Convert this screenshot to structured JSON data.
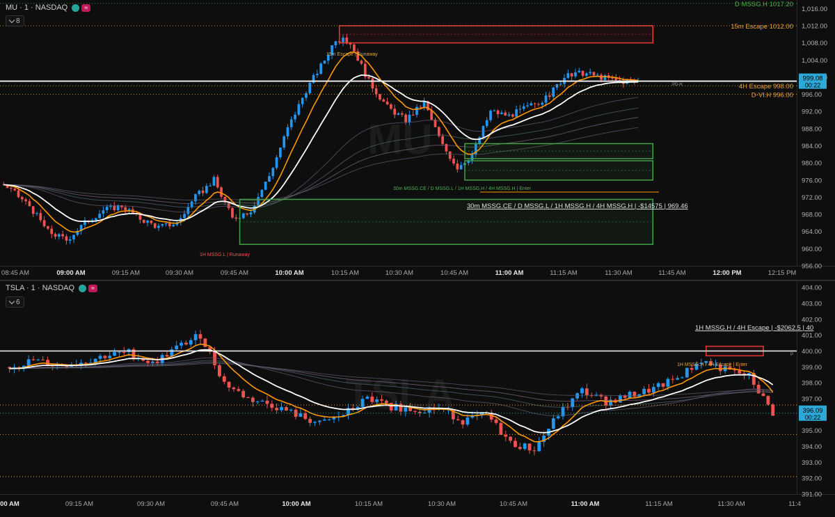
{
  "panes": [
    {
      "symbol_title": "MU · 1 · NASDAQ",
      "indicator_count": "8",
      "watermark": "MU",
      "price_tag": {
        "value": "999.08",
        "time": "00:22"
      },
      "y_ticks": [
        "1,016.00",
        "1,012.00",
        "1,008.00",
        "1,004.00",
        "1,000.00",
        "996.00",
        "992.00",
        "988.00",
        "984.00",
        "980.00",
        "976.00",
        "972.00",
        "968.00",
        "964.00",
        "960.00",
        "956.00"
      ],
      "x_ticks": [
        {
          "label": "08:45 AM",
          "bold": false
        },
        {
          "label": "09:00 AM",
          "bold": true
        },
        {
          "label": "09:15 AM",
          "bold": false
        },
        {
          "label": "09:30 AM",
          "bold": false
        },
        {
          "label": "09:45 AM",
          "bold": false
        },
        {
          "label": "10:00 AM",
          "bold": true
        },
        {
          "label": "10:15 AM",
          "bold": false
        },
        {
          "label": "10:30 AM",
          "bold": false
        },
        {
          "label": "10:45 AM",
          "bold": false
        },
        {
          "label": "11:00 AM",
          "bold": true
        },
        {
          "label": "11:15 AM",
          "bold": false
        },
        {
          "label": "11:30 AM",
          "bold": false
        },
        {
          "label": "11:45 AM",
          "bold": false
        },
        {
          "label": "12:00 PM",
          "bold": true
        },
        {
          "label": "12:15 PM",
          "bold": false
        }
      ],
      "levels": [
        {
          "label": "D MSSG.H  1017.20",
          "color": "#4caf50",
          "value": 1017.2
        },
        {
          "label": "15m Escape  1012.00",
          "color": "#e6a23c",
          "value": 1012.0
        },
        {
          "label": "4H Escape  998.00",
          "color": "#e6a23c",
          "value": 998.0
        },
        {
          "label": "D-VI.H  996.00",
          "color": "#e6a23c",
          "value": 996.0
        }
      ],
      "annotations": [
        {
          "text": "15m Escape | Runaway",
          "color": "#e6a23c"
        },
        {
          "text": "30m MSSG.CE / D MSSG.L / 1H MSSG.H / 4H MSSG.H | Enter",
          "color": "#4caf50"
        },
        {
          "text": "30m MSSG.CE / D MSSG.L / 1H MSSG.H / 4H MSSG.H | -$14575 | 969.46",
          "color": "#e0e0e0"
        },
        {
          "text": "1H MSSG.L | Runaway",
          "color": "#ef5350"
        },
        {
          "text": "PD-H",
          "color": "#9e9e9e"
        }
      ]
    },
    {
      "symbol_title": "TSLA · 1 · NASDAQ",
      "indicator_count": "6",
      "watermark": "TSLA",
      "price_tag": {
        "value": "396.09",
        "time": "00:22"
      },
      "y_ticks": [
        "404.00",
        "403.00",
        "402.00",
        "401.00",
        "400.00",
        "399.00",
        "398.00",
        "397.00",
        "396.00",
        "395.00",
        "394.00",
        "393.00",
        "392.00",
        "391.00"
      ],
      "x_ticks": [
        {
          "label": "00 AM",
          "bold": true
        },
        {
          "label": "09:15 AM",
          "bold": false
        },
        {
          "label": "09:30 AM",
          "bold": false
        },
        {
          "label": "09:45 AM",
          "bold": false
        },
        {
          "label": "10:00 AM",
          "bold": true
        },
        {
          "label": "10:15 AM",
          "bold": false
        },
        {
          "label": "10:30 AM",
          "bold": false
        },
        {
          "label": "10:45 AM",
          "bold": false
        },
        {
          "label": "11:00 AM",
          "bold": true
        },
        {
          "label": "11:15 AM",
          "bold": false
        },
        {
          "label": "11:30 AM",
          "bold": false
        },
        {
          "label": "11:4",
          "bold": false
        }
      ],
      "annotations": [
        {
          "text": "1H MSSG.H / 4H Escape | -$2062.5 | 40",
          "color": "#e0e0e0"
        },
        {
          "text": "1H MSSG.H / 4H Escape | Enter",
          "color": "#e6a23c"
        },
        {
          "text": "P",
          "color": "#9e9e9e"
        }
      ]
    }
  ],
  "chart_data": [
    {
      "type": "candlestick",
      "symbol": "MU · 1 · NASDAQ",
      "ylim": [
        956,
        1018
      ],
      "x_domain": [
        "08:42 AM",
        "12:18 PM"
      ],
      "grid": false,
      "colors": {
        "up": "#2196f3",
        "down": "#ef5350",
        "ema_fast": "#ff9800",
        "ema_slow": "#ffffff"
      },
      "close_path": [
        [
          "08:43 AM",
          975
        ],
        [
          "08:50 AM",
          970
        ],
        [
          "08:55 AM",
          964
        ],
        [
          "09:00 AM",
          962
        ],
        [
          "09:05 AM",
          966
        ],
        [
          "09:10 AM",
          969
        ],
        [
          "09:15 AM",
          970
        ],
        [
          "09:20 AM",
          967
        ],
        [
          "09:25 AM",
          965
        ],
        [
          "09:30 AM",
          966
        ],
        [
          "09:35 AM",
          972
        ],
        [
          "09:40 AM",
          976
        ],
        [
          "09:45 AM",
          967
        ],
        [
          "09:50 AM",
          969
        ],
        [
          "09:55 AM",
          977
        ],
        [
          "10:00 AM",
          988
        ],
        [
          "10:05 AM",
          997
        ],
        [
          "10:10 AM",
          1004
        ],
        [
          "10:13 AM",
          1009
        ],
        [
          "10:17 AM",
          1008
        ],
        [
          "10:22 AM",
          999
        ],
        [
          "10:27 AM",
          993
        ],
        [
          "10:32 AM",
          990
        ],
        [
          "10:37 AM",
          994
        ],
        [
          "10:42 AM",
          984
        ],
        [
          "10:46 AM",
          979
        ],
        [
          "10:50 AM",
          982
        ],
        [
          "10:55 AM",
          992
        ],
        [
          "11:00 AM",
          991
        ],
        [
          "11:05 AM",
          993
        ],
        [
          "11:10 AM",
          995
        ],
        [
          "11:15 AM",
          1000
        ],
        [
          "11:20 AM",
          1001
        ],
        [
          "11:25 AM",
          1000
        ],
        [
          "11:30 AM",
          999
        ],
        [
          "11:35 AM",
          999
        ]
      ],
      "zones": [
        {
          "name": "15m Escape supply",
          "color": "#e53935",
          "time_start": "10:14 AM",
          "time_end": "11:39 AM",
          "y_low": 1008.0,
          "y_high": 1012.0
        },
        {
          "name": "upper demand",
          "color": "#43a047",
          "time_start": "10:48 AM",
          "time_end": "11:39 AM",
          "y_low": 981.0,
          "y_high": 984.5
        },
        {
          "name": "lower demand",
          "color": "#43a047",
          "time_start": "10:48 AM",
          "time_end": "11:39 AM",
          "y_low": 976.0,
          "y_high": 980.5
        },
        {
          "name": "1H MSSG.L demand",
          "color": "#43a047",
          "time_start": "09:47 AM",
          "time_end": "11:39 AM",
          "y_low": 961.0,
          "y_high": 971.5
        }
      ]
    },
    {
      "type": "candlestick",
      "symbol": "TSLA · 1 · NASDAQ",
      "ylim": [
        391,
        404.4
      ],
      "x_domain": [
        "08:58 AM",
        "11:45 AM"
      ],
      "grid": false,
      "colors": {
        "up": "#2196f3",
        "down": "#ef5350",
        "ema_fast": "#ff9800",
        "ema_slow": "#ffffff"
      },
      "close_path": [
        [
          "09:00 AM",
          399.0
        ],
        [
          "09:05 AM",
          399.4
        ],
        [
          "09:10 AM",
          399.1
        ],
        [
          "09:15 AM",
          399.3
        ],
        [
          "09:20 AM",
          399.7
        ],
        [
          "09:25 AM",
          399.9
        ],
        [
          "09:30 AM",
          399.2
        ],
        [
          "09:35 AM",
          400.2
        ],
        [
          "09:40 AM",
          401.0
        ],
        [
          "09:45 AM",
          398.0
        ],
        [
          "09:50 AM",
          397.0
        ],
        [
          "09:55 AM",
          396.6
        ],
        [
          "10:00 AM",
          396.0
        ],
        [
          "10:05 AM",
          395.4
        ],
        [
          "10:10 AM",
          396.0
        ],
        [
          "10:15 AM",
          397.0
        ],
        [
          "10:20 AM",
          396.5
        ],
        [
          "10:25 AM",
          396.3
        ],
        [
          "10:30 AM",
          396.4
        ],
        [
          "10:35 AM",
          395.6
        ],
        [
          "10:40 AM",
          396.0
        ],
        [
          "10:45 AM",
          394.2
        ],
        [
          "10:50 AM",
          393.8
        ],
        [
          "10:55 AM",
          396.0
        ],
        [
          "11:00 AM",
          397.5
        ],
        [
          "11:05 AM",
          396.8
        ],
        [
          "11:10 AM",
          397.2
        ],
        [
          "11:15 AM",
          397.6
        ],
        [
          "11:20 AM",
          398.3
        ],
        [
          "11:25 AM",
          399.4
        ],
        [
          "11:30 AM",
          398.8
        ],
        [
          "11:35 AM",
          398.4
        ],
        [
          "11:40 AM",
          396.1
        ]
      ],
      "zones": [
        {
          "name": "4H Escape supply",
          "color": "#e53935",
          "time_start": "11:26 AM",
          "time_end": "11:38 AM",
          "y_low": 399.7,
          "y_high": 400.3
        }
      ]
    }
  ]
}
